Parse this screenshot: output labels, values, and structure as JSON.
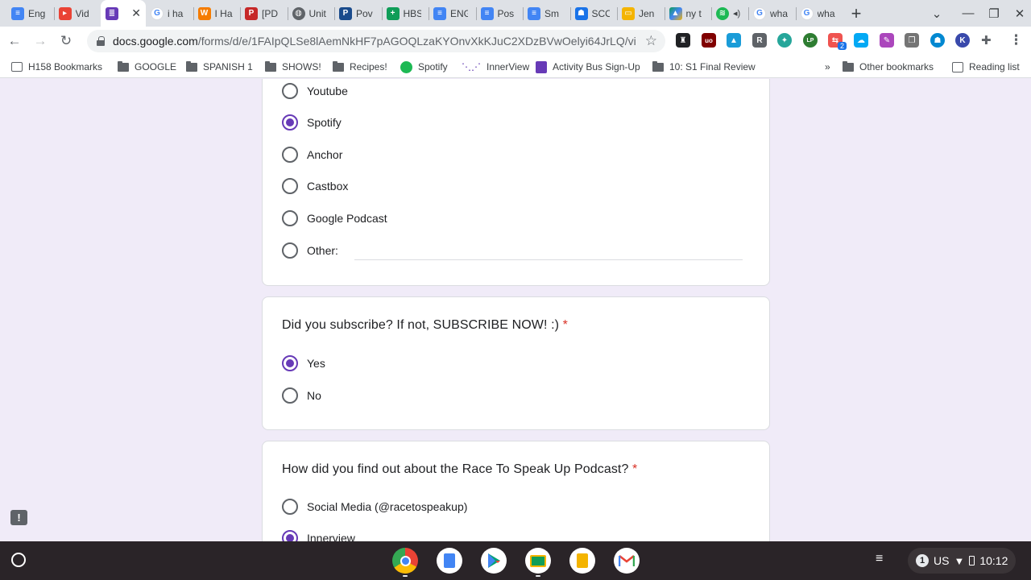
{
  "browser": {
    "tabs": [
      {
        "title": "Eng",
        "icon": "docs-icon",
        "color": "#4285f4"
      },
      {
        "title": "Vid",
        "icon": "video-icon",
        "color": "#ea4335"
      },
      {
        "title": "",
        "icon": "forms-icon",
        "color": "#673ab7",
        "active": true
      },
      {
        "title": "i ha",
        "icon": "google-icon",
        "color": "#4285f4"
      },
      {
        "title": "I Ha",
        "icon": "wattpad-icon",
        "color": "#f57c00"
      },
      {
        "title": "[PD",
        "icon": "pdf-icon",
        "color": "#c62828"
      },
      {
        "title": "Unit",
        "icon": "globe-icon",
        "color": "#5f6368"
      },
      {
        "title": "Pov",
        "icon": "pearson-icon",
        "color": "#1a4b8c"
      },
      {
        "title": "HBS",
        "icon": "sheets-plus-icon",
        "color": "#0f9d58"
      },
      {
        "title": "ENG",
        "icon": "docs-icon",
        "color": "#4285f4"
      },
      {
        "title": "Pos",
        "icon": "docs-icon",
        "color": "#4285f4"
      },
      {
        "title": "Sm",
        "icon": "docs-icon",
        "color": "#4285f4"
      },
      {
        "title": "SCO",
        "icon": "classroom-icon",
        "color": "#1a73e8"
      },
      {
        "title": "Jen",
        "icon": "slides-icon",
        "color": "#f4b400"
      },
      {
        "title": "ny t",
        "icon": "drive-icon",
        "color": "#0f9d58"
      },
      {
        "title": "",
        "icon": "spotify-icon",
        "color": "#1db954",
        "audio": true
      },
      {
        "title": "wha",
        "icon": "google-icon",
        "color": "#4285f4"
      },
      {
        "title": "wha",
        "icon": "google-icon",
        "color": "#4285f4"
      }
    ],
    "close_glyph": "✕",
    "new_tab_glyph": "+",
    "window_controls": {
      "dropdown": "⌄",
      "minimize": "—",
      "restore": "❐",
      "close": "✕"
    },
    "nav": {
      "back": "←",
      "forward": "→",
      "reload": "↻"
    },
    "url_host": "docs.google.com",
    "url_path": "/forms/d/e/1FAIpQLSe8lAemNkHF7pAGOQLzaKYOnvXkKJuC2XDzBVwOelyi64JrLQ/vie...",
    "star": "☆",
    "extensions": [
      {
        "icon": "ghost-icon",
        "color": "#202124",
        "glyph": "♜"
      },
      {
        "icon": "ublock-icon",
        "color": "#800000",
        "glyph": "uo"
      },
      {
        "icon": "pin-icon",
        "color": "#1a9cd8",
        "glyph": "▲"
      },
      {
        "icon": "r-icon",
        "color": "#5f6368",
        "glyph": "R"
      },
      {
        "icon": "compass-icon",
        "color": "#26a69a",
        "glyph": "✦"
      },
      {
        "icon": "lp-icon",
        "color": "#2e7d32",
        "glyph": "LP"
      },
      {
        "icon": "share-icon",
        "color": "#ef5350",
        "glyph": "⇆"
      },
      {
        "icon": "cloud-icon",
        "color": "#03a9f4",
        "glyph": "☁"
      },
      {
        "icon": "puzzle-purple-icon",
        "color": "#ab47bc",
        "glyph": "✎"
      },
      {
        "icon": "copy-icon",
        "color": "#757575",
        "glyph": "❐"
      },
      {
        "icon": "person-icon",
        "color": "#0288d1",
        "glyph": "☗"
      },
      {
        "icon": "k-icon",
        "color": "#3949ab",
        "glyph": "K"
      }
    ],
    "badge_count": "2",
    "extensions_glyph": "✚",
    "menu_glyph": "⋮"
  },
  "bookmarks": {
    "items": [
      {
        "label": "H158 Bookmarks",
        "icon": "bookmark-folder-icon"
      },
      {
        "label": "GOOGLE",
        "icon": "folder-icon"
      },
      {
        "label": "SPANISH 1",
        "icon": "folder-icon"
      },
      {
        "label": "SHOWS!",
        "icon": "folder-icon"
      },
      {
        "label": "Recipes!",
        "icon": "folder-icon"
      },
      {
        "label": "Spotify",
        "icon": "spotify-icon"
      },
      {
        "label": "InnerView",
        "icon": "innerview-icon"
      },
      {
        "label": "Activity Bus Sign-Up",
        "icon": "forms-icon"
      },
      {
        "label": "10: S1 Final Review",
        "icon": "folder-icon"
      }
    ],
    "overflow": "»",
    "other": "Other bookmarks",
    "reading_list": "Reading list"
  },
  "form": {
    "q_platform": {
      "options": [
        {
          "label": "Youtube",
          "selected": false
        },
        {
          "label": "Spotify",
          "selected": true
        },
        {
          "label": "Anchor",
          "selected": false
        },
        {
          "label": "Castbox",
          "selected": false
        },
        {
          "label": "Google Podcast",
          "selected": false
        },
        {
          "label": "Other:",
          "selected": false
        }
      ]
    },
    "q_subscribe": {
      "text": "Did you subscribe? If not, SUBSCRIBE NOW! :)",
      "required_mark": "*",
      "options": [
        {
          "label": "Yes",
          "selected": true
        },
        {
          "label": "No",
          "selected": false
        }
      ]
    },
    "q_findout": {
      "text": "How did you find out about the Race To Speak Up Podcast?",
      "required_mark": "*",
      "options": [
        {
          "label": "Social Media (@racetospeakup)",
          "selected": false
        },
        {
          "label": "Innerview",
          "selected": true
        }
      ]
    },
    "feedback_glyph": "!"
  },
  "shelf": {
    "apps": [
      {
        "icon": "chrome-icon"
      },
      {
        "icon": "docs-icon"
      },
      {
        "icon": "play-store-icon"
      },
      {
        "icon": "classroom-icon"
      },
      {
        "icon": "slides-icon"
      },
      {
        "icon": "gmail-icon"
      }
    ],
    "media_glyph": "≡",
    "notification_count": "1",
    "keyboard": "US",
    "time": "10:12"
  },
  "colors": {
    "accent": "#673ab7",
    "required": "#d93025",
    "page_bg": "#f0ebf8"
  }
}
